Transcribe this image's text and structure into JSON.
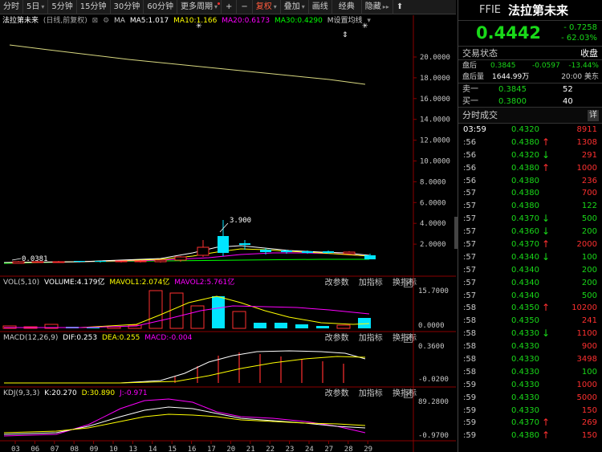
{
  "toolbar": {
    "items": [
      "分时",
      "5日",
      "5分钟",
      "15分钟",
      "30分钟",
      "60分钟",
      "更多周期",
      "+",
      "−",
      "复权",
      "叠加",
      "画线",
      "经典",
      "隐藏"
    ],
    "expand": "▸▸",
    "pin": "⬆"
  },
  "main_pane": {
    "name": "法拉第未来",
    "mode": "(日线,前复权)",
    "ma_label": "MA",
    "ma5": "MA5:1.017",
    "ma10": "MA10:1.166",
    "ma20": "MA20:0.6173",
    "ma30": "MA30:0.4290",
    "ma_settings": "M设置均线",
    "axis": [
      "20.0000",
      "18.0000",
      "16.0000",
      "14.0000",
      "12.0000",
      "10.0000",
      "8.0000",
      "6.0000",
      "4.0000",
      "2.0000"
    ],
    "annot_high": "3.900",
    "annot_low": "0.0381"
  },
  "vol_pane": {
    "title": "VOL(5,10)",
    "volume": "VOLUME:4.179亿",
    "mavol1": "MAVOL1:2.074亿",
    "mavol2": "MAVOL2:5.761亿",
    "axis": [
      "15.7000",
      "0.0000"
    ],
    "btn_params": "改参数",
    "btn_add": "加指标",
    "btn_swap": "换指标"
  },
  "macd_pane": {
    "title": "MACD(12,26,9)",
    "dif": "DIF:0.253",
    "dea": "DEA:0.255",
    "macd": "MACD:-0.004",
    "axis": [
      "0.3600",
      "-0.0200"
    ],
    "btn_params": "改参数",
    "btn_add": "加指标",
    "btn_swap": "换指标"
  },
  "kdj_pane": {
    "title": "KDJ(9,3,3)",
    "k": "K:20.270",
    "d": "D:30.890",
    "j": "J:-0.971",
    "axis": [
      "89.2800",
      "-0.9700"
    ],
    "btn_params": "改参数",
    "btn_add": "加指标",
    "btn_swap": "换指标"
  },
  "x_axis": [
    "03",
    "06",
    "07",
    "08",
    "09",
    "10",
    "13",
    "14",
    "15",
    "16",
    "17",
    "20",
    "21",
    "22",
    "23",
    "24",
    "27",
    "28",
    "29"
  ],
  "quote": {
    "symbol": "FFIE",
    "name": "法拉第未来",
    "price": "0.4442",
    "change": "- 0.7258",
    "change_pct": "- 62.03%",
    "status_label": "交易状态",
    "status_value": "收盘",
    "after_label": "盘后",
    "after_price": "0.3845",
    "after_change": "-0.0597",
    "after_pct": "-13.44%",
    "after_vol_label": "盘后量",
    "after_vol": "1644.99万",
    "after_time": "20:00 美东",
    "sell_label": "卖一",
    "sell_price": "0.3845",
    "sell_qty": "52",
    "buy_label": "买一",
    "buy_price": "0.3800",
    "buy_qty": "40",
    "ticks_label": "分时成交",
    "ticks_btn": "详"
  },
  "ticks": [
    {
      "t": "03:59",
      "p": "0.4320",
      "a": "",
      "v": "8911",
      "c": "#ff3030"
    },
    {
      "t": ":56",
      "p": "0.4380",
      "a": "↑",
      "v": "1308",
      "c": "#ff3030"
    },
    {
      "t": ":56",
      "p": "0.4320",
      "a": "↓",
      "v": "291",
      "c": "#ff3030"
    },
    {
      "t": ":56",
      "p": "0.4380",
      "a": "↑",
      "v": "1000",
      "c": "#ff3030"
    },
    {
      "t": ":56",
      "p": "0.4380",
      "a": "",
      "v": "236",
      "c": "#ff3030"
    },
    {
      "t": ":57",
      "p": "0.4380",
      "a": "",
      "v": "700",
      "c": "#ff3030"
    },
    {
      "t": ":57",
      "p": "0.4380",
      "a": "",
      "v": "122",
      "c": "#19d919"
    },
    {
      "t": ":57",
      "p": "0.4370",
      "a": "↓",
      "v": "500",
      "c": "#19d919"
    },
    {
      "t": ":57",
      "p": "0.4360",
      "a": "↓",
      "v": "200",
      "c": "#19d919"
    },
    {
      "t": ":57",
      "p": "0.4370",
      "a": "↑",
      "v": "2000",
      "c": "#ff3030"
    },
    {
      "t": ":57",
      "p": "0.4340",
      "a": "↓",
      "v": "100",
      "c": "#19d919"
    },
    {
      "t": ":57",
      "p": "0.4340",
      "a": "",
      "v": "200",
      "c": "#19d919"
    },
    {
      "t": ":57",
      "p": "0.4340",
      "a": "",
      "v": "200",
      "c": "#19d919"
    },
    {
      "t": ":57",
      "p": "0.4340",
      "a": "",
      "v": "500",
      "c": "#19d919"
    },
    {
      "t": ":58",
      "p": "0.4350",
      "a": "↑",
      "v": "10200",
      "c": "#ff3030"
    },
    {
      "t": ":58",
      "p": "0.4350",
      "a": "",
      "v": "241",
      "c": "#ff3030"
    },
    {
      "t": ":58",
      "p": "0.4330",
      "a": "↓",
      "v": "1100",
      "c": "#ff3030"
    },
    {
      "t": ":58",
      "p": "0.4330",
      "a": "",
      "v": "900",
      "c": "#ff3030"
    },
    {
      "t": ":58",
      "p": "0.4330",
      "a": "",
      "v": "3498",
      "c": "#ff3030"
    },
    {
      "t": ":58",
      "p": "0.4330",
      "a": "",
      "v": "100",
      "c": "#19d919"
    },
    {
      "t": ":59",
      "p": "0.4330",
      "a": "",
      "v": "1000",
      "c": "#ff3030"
    },
    {
      "t": ":59",
      "p": "0.4330",
      "a": "",
      "v": "5000",
      "c": "#ff3030"
    },
    {
      "t": ":59",
      "p": "0.4330",
      "a": "",
      "v": "150",
      "c": "#ff3030"
    },
    {
      "t": ":59",
      "p": "0.4370",
      "a": "↑",
      "v": "269",
      "c": "#ff3030"
    },
    {
      "t": ":59",
      "p": "0.4380",
      "a": "↑",
      "v": "150",
      "c": "#ff3030"
    }
  ],
  "colors": {
    "up": "#ff3030",
    "down": "#19d919",
    "cyan": "#00e5ff",
    "ma5": "#ffffff",
    "ma10": "#ffff00",
    "ma20": "#ff00ff",
    "ma30": "#00ff00"
  }
}
